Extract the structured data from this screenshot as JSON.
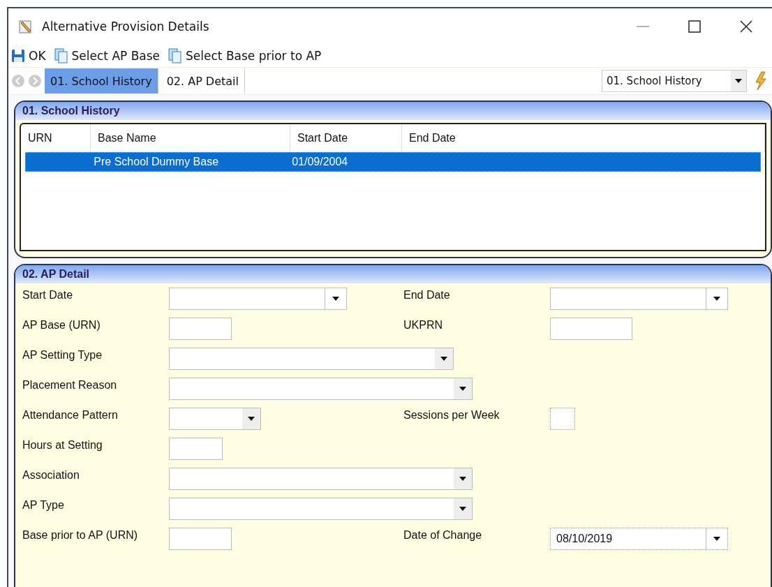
{
  "window": {
    "title": "Alternative Provision Details"
  },
  "toolbar": [
    {
      "kind": "save",
      "label": "OK"
    },
    {
      "kind": "copy",
      "label": "Select AP Base"
    },
    {
      "kind": "copy",
      "label": "Select Base prior to AP"
    }
  ],
  "tabs": [
    {
      "label": "01. School History",
      "selected": true
    },
    {
      "label": "02. AP Detail",
      "selected": false
    }
  ],
  "section_select": {
    "value": "01. School History"
  },
  "school_history": {
    "title": "01. School History",
    "columns": [
      "URN",
      "Base Name",
      "Start Date",
      "End Date"
    ],
    "rows": [
      {
        "cells": [
          "",
          "Pre School Dummy Base",
          "01/09/2004",
          ""
        ],
        "selected": true
      }
    ]
  },
  "ap_detail": {
    "title": "02. AP Detail",
    "rows": [
      {
        "label": "Start Date",
        "field": {
          "kind": "date",
          "read_only": false
        },
        "right": {
          "label": "End Date",
          "field": {
            "kind": "date",
            "read_only": false
          }
        }
      },
      {
        "label": "AP Base (URN)",
        "field": {
          "kind": "text",
          "read_only": false
        },
        "right": {
          "label": "UKPRN",
          "field": {
            "kind": "wide-text",
            "read_only": false
          }
        }
      },
      {
        "label": "AP Setting Type",
        "field": {
          "kind": "medium-combo",
          "read_only": false
        }
      },
      {
        "label": "Placement Reason",
        "field": {
          "kind": "combo",
          "read_only": false
        }
      },
      {
        "label": "Attendance Pattern",
        "field": {
          "kind": "small-combo",
          "read_only": false
        },
        "right": {
          "label": "Sessions per Week",
          "field": {
            "kind": "tiny-text",
            "read_only": true
          }
        }
      },
      {
        "label": "Hours at Setting",
        "field": {
          "kind": "short-text",
          "read_only": false
        }
      },
      {
        "label": "Association",
        "field": {
          "kind": "combo",
          "read_only": false
        }
      },
      {
        "label": "AP Type",
        "field": {
          "kind": "combo",
          "read_only": false
        }
      },
      {
        "label": "Base prior to AP (URN)",
        "field": {
          "kind": "text",
          "read_only": false
        },
        "right": {
          "label": "Date of Change",
          "field": {
            "kind": "date",
            "value": "08/10/2019",
            "read_only": true
          }
        }
      }
    ]
  }
}
